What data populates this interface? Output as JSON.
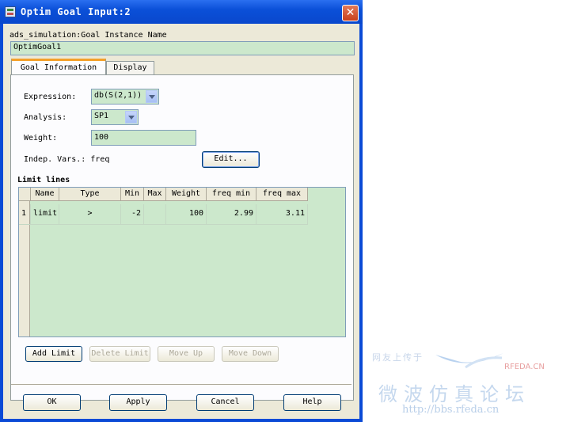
{
  "window": {
    "title": "Optim Goal Input:2",
    "icon": "app-icon",
    "close_icon": "close-icon",
    "close_glyph": "✕"
  },
  "instance": {
    "label": "ads_simulation:Goal Instance Name",
    "value": "OptimGoal1"
  },
  "tabs": [
    {
      "label": "Goal Information",
      "active": true
    },
    {
      "label": "Display",
      "active": false
    }
  ],
  "goal": {
    "expression_label": "Expression:",
    "expression_value": "db(S(2,1))",
    "analysis_label": "Analysis:",
    "analysis_value": "SP1",
    "weight_label": "Weight:",
    "weight_value": "100",
    "indep_label": "Indep. Vars.: freq",
    "edit_label": "Edit..."
  },
  "limits": {
    "title": "Limit lines",
    "columns": [
      "Name",
      "Type",
      "Min",
      "Max",
      "Weight",
      "freq min",
      "freq max"
    ],
    "rows": [
      {
        "index": "1",
        "name": "limit",
        "type": ">",
        "min": "-2",
        "max": "",
        "weight": "100",
        "freq_min": "2.99",
        "freq_max": "3.11"
      }
    ]
  },
  "limit_buttons": {
    "add": "Add Limit",
    "delete": "Delete Limit",
    "move_up": "Move Up",
    "move_down": "Move Down"
  },
  "footer": {
    "ok": "OK",
    "apply": "Apply",
    "cancel": "Cancel",
    "help": "Help"
  },
  "watermark": {
    "line1": "网友上传于",
    "brand": "RFEDA.CN",
    "chinese": "微波仿真论坛",
    "url": "http://bbs.rfeda.cn"
  },
  "colors": {
    "title_bar": "#0b50d8",
    "field_bg": "#cce8cc",
    "dialog_bg": "#ece9d8",
    "active_tab_accent": "#f4a02a"
  }
}
